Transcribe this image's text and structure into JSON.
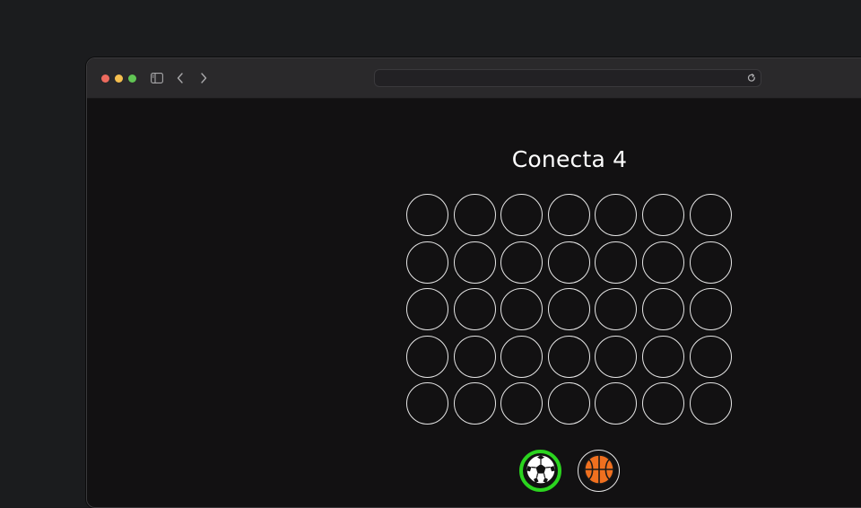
{
  "browser": {
    "address_value": "",
    "buttons": [
      "sidebar-toggle",
      "back",
      "forward",
      "reload"
    ]
  },
  "game": {
    "title": "Conecta 4",
    "rows": 5,
    "columns": 7,
    "players": [
      {
        "name": "soccer-ball",
        "active": true
      },
      {
        "name": "basketball",
        "active": false
      }
    ],
    "active_color": "#2bd41f",
    "cell_border_color": "#e6e6e6"
  }
}
